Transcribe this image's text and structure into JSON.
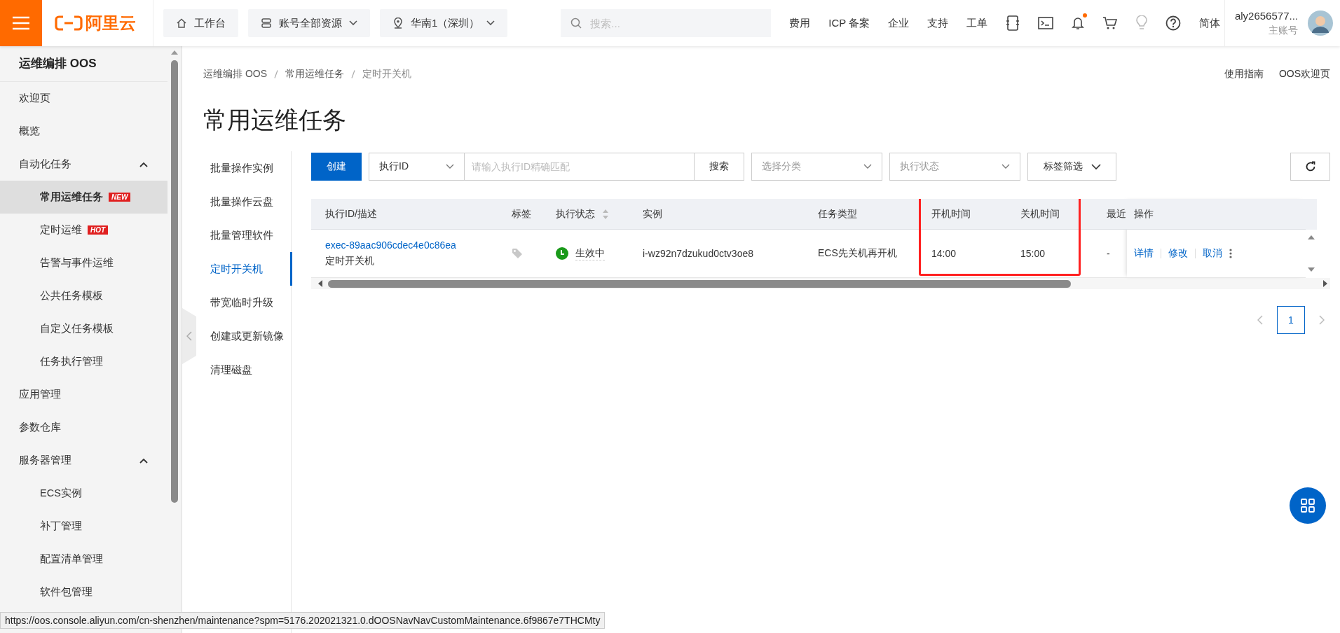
{
  "top_bar": {
    "logo": "阿里云",
    "nav": [
      {
        "label": "工作台",
        "kind": "home",
        "dropdown": false
      },
      {
        "label": "账号全部资源",
        "kind": "resources",
        "dropdown": true
      },
      {
        "label": "华南1（深圳）",
        "kind": "region",
        "dropdown": true
      }
    ],
    "search": {
      "placeholder": "搜索..."
    },
    "links": [
      "费用",
      "ICP 备案",
      "企业",
      "支持",
      "工单"
    ],
    "bell_unread": true,
    "language": "简体",
    "account": {
      "name": "aly2656577...",
      "role": "主账号"
    }
  },
  "sidebar": {
    "title": "运维编排 OOS",
    "items": [
      {
        "label": "欢迎页",
        "selected": false
      },
      {
        "label": "概览",
        "selected": false
      },
      {
        "label": "自动化任务",
        "selected": false,
        "expanded": true,
        "children": [
          {
            "label": "常用运维任务",
            "badge": "NEW",
            "selected": true
          },
          {
            "label": "定时运维",
            "badge": "HOT",
            "selected": false
          },
          {
            "label": "告警与事件运维",
            "selected": false
          },
          {
            "label": "公共任务模板",
            "selected": false
          },
          {
            "label": "自定义任务模板",
            "selected": false
          },
          {
            "label": "任务执行管理",
            "selected": false
          }
        ]
      },
      {
        "label": "应用管理",
        "selected": false
      },
      {
        "label": "参数仓库",
        "selected": false
      },
      {
        "label": "服务器管理",
        "selected": false,
        "expanded": true,
        "children": [
          {
            "label": "ECS实例",
            "selected": false
          },
          {
            "label": "补丁管理",
            "selected": false
          },
          {
            "label": "配置清单管理",
            "selected": false
          },
          {
            "label": "软件包管理",
            "selected": false
          }
        ]
      }
    ]
  },
  "breadcrumb": [
    "运维编排 OOS",
    "常用运维任务",
    "定时开关机"
  ],
  "header_links": [
    "使用指南",
    "OOS欢迎页"
  ],
  "page_title": "常用运维任务",
  "sub_nav": [
    {
      "label": "批量操作实例",
      "selected": false
    },
    {
      "label": "批量操作云盘",
      "selected": false
    },
    {
      "label": "批量管理软件",
      "selected": false
    },
    {
      "label": "定时开关机",
      "selected": true
    },
    {
      "label": "带宽临时升级",
      "selected": false
    },
    {
      "label": "创建或更新镜像",
      "selected": false
    },
    {
      "label": "清理磁盘",
      "selected": false
    }
  ],
  "toolbar": {
    "create_button": "创建",
    "id_select": "执行ID",
    "search": {
      "placeholder": "请输入执行ID精确匹配"
    },
    "search_button": "搜索",
    "category_select": {
      "placeholder": "选择分类"
    },
    "status_select": {
      "placeholder": "执行状态"
    },
    "tag_filter": "标签筛选"
  },
  "table": {
    "columns": [
      {
        "label": "执行ID/描述",
        "sortable": false,
        "highlighted": false
      },
      {
        "label": "标签",
        "sortable": false,
        "highlighted": false
      },
      {
        "label": "执行状态",
        "sortable": true,
        "highlighted": false
      },
      {
        "label": "实例",
        "sortable": false,
        "highlighted": false
      },
      {
        "label": "任务类型",
        "sortable": false,
        "highlighted": false
      },
      {
        "label": "开机时间",
        "sortable": false,
        "highlighted": true
      },
      {
        "label": "关机时间",
        "sortable": false,
        "highlighted": true
      },
      {
        "label": "最近",
        "sortable": false,
        "highlighted": false
      }
    ],
    "action_column": "操作",
    "rows": [
      {
        "id": "exec-89aac906cdec4e0c86ea",
        "description": "定时开关机",
        "status": "生效中",
        "instance": "i-wz92n7dzukud0ctv3oe8",
        "task_type": "ECS先关机再开机",
        "start_time": "14:00",
        "stop_time": "15:00",
        "recent": "-",
        "actions": [
          "详情",
          "修改",
          "取消"
        ]
      }
    ]
  },
  "pagination": {
    "pages": [
      {
        "label": "1",
        "selected": true
      }
    ]
  },
  "status_bar": "https://oos.console.aliyun.com/cn-shenzhen/maintenance?spm=5176.202021321.0.dOOSNavNavCustomMaintenance.6f9867e7THCMty"
}
